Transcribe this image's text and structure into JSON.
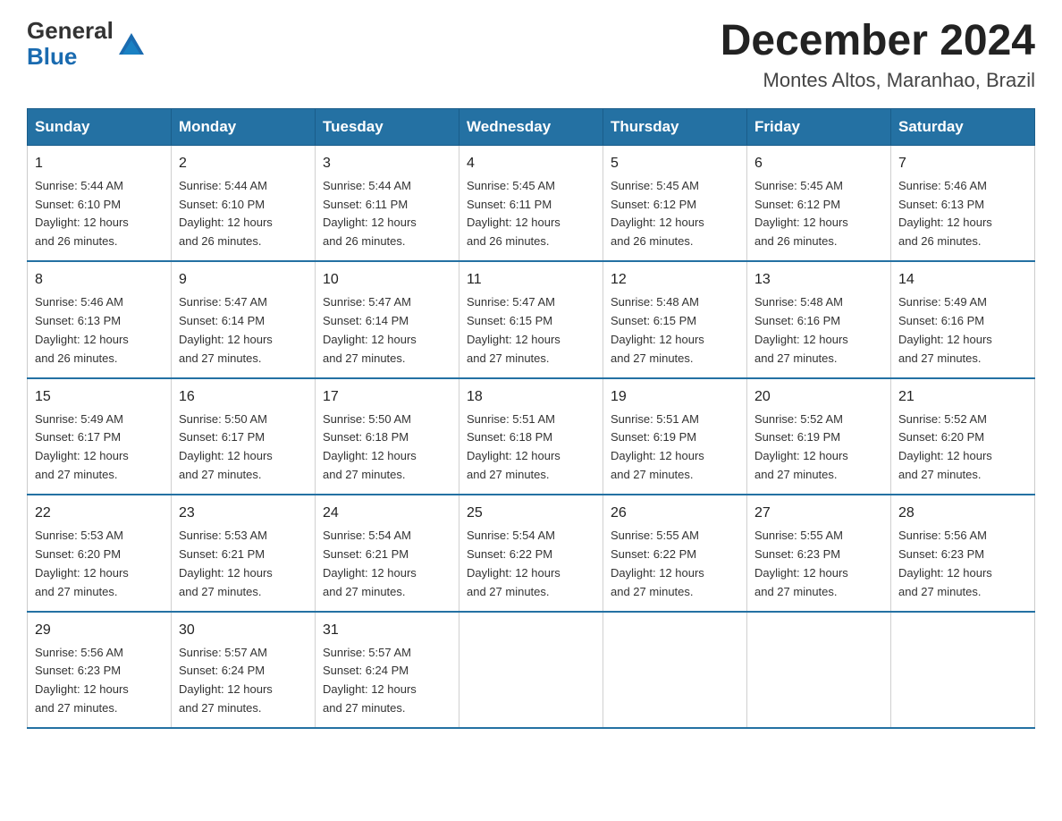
{
  "header": {
    "logo_text_general": "General",
    "logo_text_blue": "Blue",
    "month_year": "December 2024",
    "location": "Montes Altos, Maranhao, Brazil"
  },
  "days_of_week": [
    "Sunday",
    "Monday",
    "Tuesday",
    "Wednesday",
    "Thursday",
    "Friday",
    "Saturday"
  ],
  "weeks": [
    [
      {
        "day": "1",
        "sunrise": "5:44 AM",
        "sunset": "6:10 PM",
        "daylight": "12 hours and 26 minutes."
      },
      {
        "day": "2",
        "sunrise": "5:44 AM",
        "sunset": "6:10 PM",
        "daylight": "12 hours and 26 minutes."
      },
      {
        "day": "3",
        "sunrise": "5:44 AM",
        "sunset": "6:11 PM",
        "daylight": "12 hours and 26 minutes."
      },
      {
        "day": "4",
        "sunrise": "5:45 AM",
        "sunset": "6:11 PM",
        "daylight": "12 hours and 26 minutes."
      },
      {
        "day": "5",
        "sunrise": "5:45 AM",
        "sunset": "6:12 PM",
        "daylight": "12 hours and 26 minutes."
      },
      {
        "day": "6",
        "sunrise": "5:45 AM",
        "sunset": "6:12 PM",
        "daylight": "12 hours and 26 minutes."
      },
      {
        "day": "7",
        "sunrise": "5:46 AM",
        "sunset": "6:13 PM",
        "daylight": "12 hours and 26 minutes."
      }
    ],
    [
      {
        "day": "8",
        "sunrise": "5:46 AM",
        "sunset": "6:13 PM",
        "daylight": "12 hours and 26 minutes."
      },
      {
        "day": "9",
        "sunrise": "5:47 AM",
        "sunset": "6:14 PM",
        "daylight": "12 hours and 27 minutes."
      },
      {
        "day": "10",
        "sunrise": "5:47 AM",
        "sunset": "6:14 PM",
        "daylight": "12 hours and 27 minutes."
      },
      {
        "day": "11",
        "sunrise": "5:47 AM",
        "sunset": "6:15 PM",
        "daylight": "12 hours and 27 minutes."
      },
      {
        "day": "12",
        "sunrise": "5:48 AM",
        "sunset": "6:15 PM",
        "daylight": "12 hours and 27 minutes."
      },
      {
        "day": "13",
        "sunrise": "5:48 AM",
        "sunset": "6:16 PM",
        "daylight": "12 hours and 27 minutes."
      },
      {
        "day": "14",
        "sunrise": "5:49 AM",
        "sunset": "6:16 PM",
        "daylight": "12 hours and 27 minutes."
      }
    ],
    [
      {
        "day": "15",
        "sunrise": "5:49 AM",
        "sunset": "6:17 PM",
        "daylight": "12 hours and 27 minutes."
      },
      {
        "day": "16",
        "sunrise": "5:50 AM",
        "sunset": "6:17 PM",
        "daylight": "12 hours and 27 minutes."
      },
      {
        "day": "17",
        "sunrise": "5:50 AM",
        "sunset": "6:18 PM",
        "daylight": "12 hours and 27 minutes."
      },
      {
        "day": "18",
        "sunrise": "5:51 AM",
        "sunset": "6:18 PM",
        "daylight": "12 hours and 27 minutes."
      },
      {
        "day": "19",
        "sunrise": "5:51 AM",
        "sunset": "6:19 PM",
        "daylight": "12 hours and 27 minutes."
      },
      {
        "day": "20",
        "sunrise": "5:52 AM",
        "sunset": "6:19 PM",
        "daylight": "12 hours and 27 minutes."
      },
      {
        "day": "21",
        "sunrise": "5:52 AM",
        "sunset": "6:20 PM",
        "daylight": "12 hours and 27 minutes."
      }
    ],
    [
      {
        "day": "22",
        "sunrise": "5:53 AM",
        "sunset": "6:20 PM",
        "daylight": "12 hours and 27 minutes."
      },
      {
        "day": "23",
        "sunrise": "5:53 AM",
        "sunset": "6:21 PM",
        "daylight": "12 hours and 27 minutes."
      },
      {
        "day": "24",
        "sunrise": "5:54 AM",
        "sunset": "6:21 PM",
        "daylight": "12 hours and 27 minutes."
      },
      {
        "day": "25",
        "sunrise": "5:54 AM",
        "sunset": "6:22 PM",
        "daylight": "12 hours and 27 minutes."
      },
      {
        "day": "26",
        "sunrise": "5:55 AM",
        "sunset": "6:22 PM",
        "daylight": "12 hours and 27 minutes."
      },
      {
        "day": "27",
        "sunrise": "5:55 AM",
        "sunset": "6:23 PM",
        "daylight": "12 hours and 27 minutes."
      },
      {
        "day": "28",
        "sunrise": "5:56 AM",
        "sunset": "6:23 PM",
        "daylight": "12 hours and 27 minutes."
      }
    ],
    [
      {
        "day": "29",
        "sunrise": "5:56 AM",
        "sunset": "6:23 PM",
        "daylight": "12 hours and 27 minutes."
      },
      {
        "day": "30",
        "sunrise": "5:57 AM",
        "sunset": "6:24 PM",
        "daylight": "12 hours and 27 minutes."
      },
      {
        "day": "31",
        "sunrise": "5:57 AM",
        "sunset": "6:24 PM",
        "daylight": "12 hours and 27 minutes."
      },
      null,
      null,
      null,
      null
    ]
  ],
  "labels": {
    "sunrise_prefix": "Sunrise: ",
    "sunset_prefix": "Sunset: ",
    "daylight_prefix": "Daylight: "
  },
  "colors": {
    "header_bg": "#2471a3",
    "header_text": "#ffffff",
    "accent": "#1a6bb0"
  }
}
